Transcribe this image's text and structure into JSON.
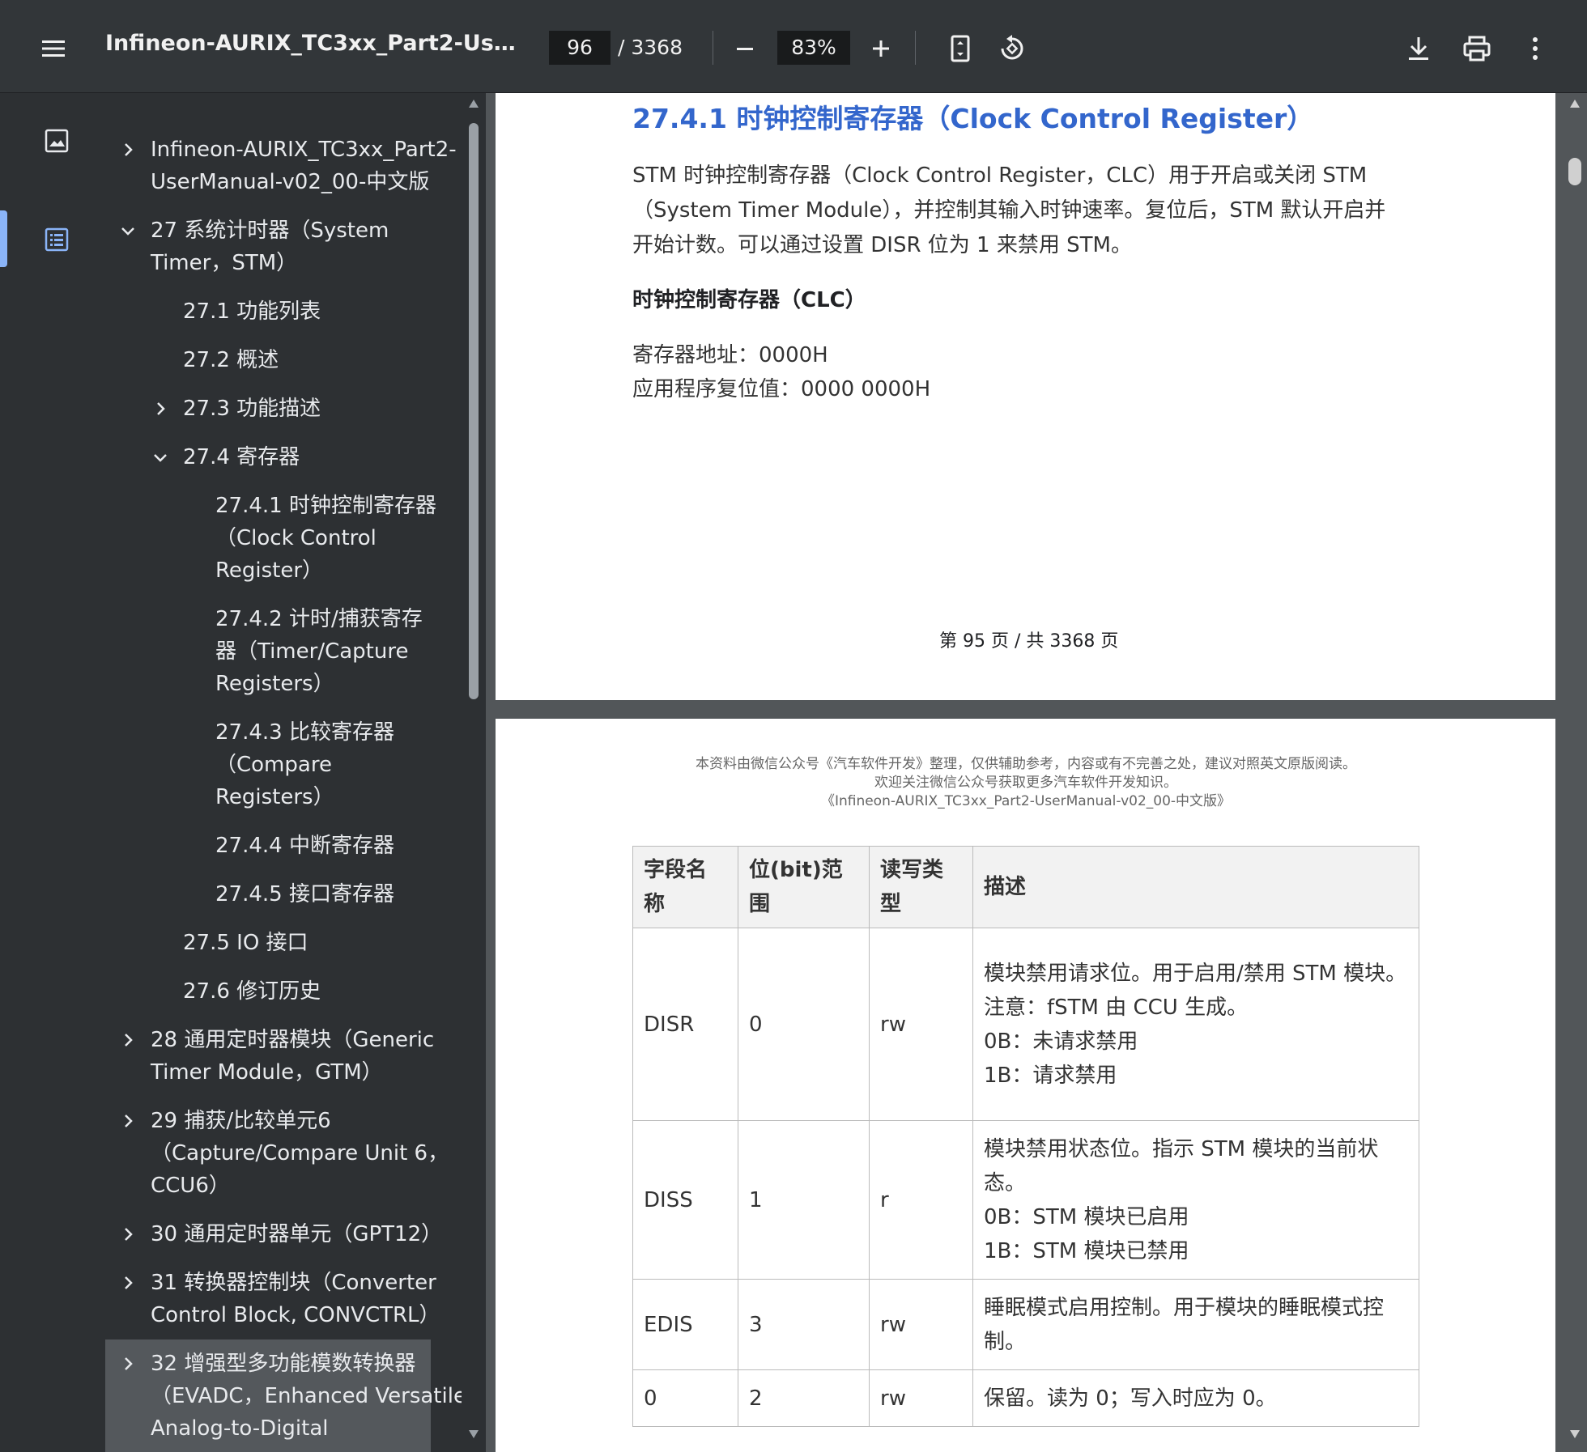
{
  "toolbar": {
    "title": "Infineon-AURIX_TC3xx_Part2-UserMan...",
    "page_current": "96",
    "page_total": "/ 3368",
    "zoom": "83%",
    "icons": [
      "menu-icon",
      "zoom-out-icon",
      "zoom-in-icon",
      "fit-page-icon",
      "rotate-icon",
      "download-icon",
      "print-icon",
      "more-vert-icon"
    ]
  },
  "outline": {
    "items": [
      {
        "label1": "Infineon-AURIX_TC3xx_Part2-",
        "label2": "UserManual-v02_00-中文版",
        "chevron": "right"
      },
      {
        "label1": "27 系统计时器（System",
        "label2": "Timer，STM）",
        "chevron": "down"
      },
      {
        "label1": "27.1 功能列表"
      },
      {
        "label1": "27.2 概述"
      },
      {
        "label1": "27.3 功能描述",
        "chevron": "right"
      },
      {
        "label1": "27.4 寄存器",
        "chevron": "down"
      },
      {
        "label1": "27.4.1 时钟控制寄存器",
        "label2": "（Clock Control",
        "label3": "Register）"
      },
      {
        "label1": "27.4.2 计时/捕获寄存",
        "label2": "器（Timer/Capture",
        "label3": "Registers）"
      },
      {
        "label1": "27.4.3 比较寄存器",
        "label2": "（Compare",
        "label3": "Registers）"
      },
      {
        "label1": "27.4.4 中断寄存器"
      },
      {
        "label1": "27.4.5 接口寄存器"
      },
      {
        "label1": "27.5 IO 接口"
      },
      {
        "label1": "27.6 修订历史"
      },
      {
        "label1": "28 通用定时器模块（Generic",
        "label2": "Timer Module，GTM）",
        "chevron": "right"
      },
      {
        "label1": "29 捕获/比较单元6",
        "label2": "（Capture/Compare Unit 6，",
        "label3": "CCU6）",
        "chevron": "right"
      },
      {
        "label1": "30 通用定时器单元（GPT12）",
        "chevron": "right"
      },
      {
        "label1": "31 转换器控制块（Converter",
        "label2": "Control Block, CONVCTRL）",
        "chevron": "right"
      },
      {
        "label1": "32 增强型多功能模数转换器",
        "label2": "（EVADC，Enhanced Versatile",
        "label3": "Analog-to-Digital",
        "chevron": "right"
      }
    ]
  },
  "page95": {
    "heading": "27.4.1 时钟控制寄存器（Clock Control Register）",
    "para_line1": "STM 时钟控制寄存器（Clock Control Register，CLC）用于开启或关闭 STM",
    "para_line2": "（System Timer Module），并控制其输入时钟速率。复位后，STM 默认开启并",
    "para_line3": "开始计数。可以通过设置 DISR 位为 1 来禁用 STM。",
    "subheading": "时钟控制寄存器（CLC）",
    "addr": "寄存器地址：0000H",
    "reset": "应用程序复位值：0000 0000H",
    "footer": "第 95 页 / 共 3368 页"
  },
  "page96": {
    "note1": "本资料由微信公众号《汽车软件开发》整理，仅供辅助参考，内容或有不完善之处，建议对照英文原版阅读。",
    "note2": "欢迎关注微信公众号获取更多汽车软件开发知识。",
    "note3": "《Infineon-AURIX_TC3xx_Part2-UserManual-v02_00-中文版》",
    "table": {
      "headers": [
        "字段名称",
        "位(bit)范围",
        "读写类型",
        "描述"
      ],
      "rows": [
        {
          "field": "DISR",
          "bits": "0",
          "type": "rw",
          "desc": [
            "模块禁用请求位。用于启用/禁用 STM 模块。",
            "注意：fSTM 由 CCU 生成。",
            "0B：未请求禁用",
            "1B：请求禁用"
          ]
        },
        {
          "field": "DISS",
          "bits": "1",
          "type": "r",
          "desc": [
            "模块禁用状态位。指示 STM 模块的当前状态。",
            "0B：STM 模块已启用",
            "1B：STM 模块已禁用"
          ]
        },
        {
          "field": "EDIS",
          "bits": "3",
          "type": "rw",
          "desc": [
            "睡眠模式启用控制。用于模块的睡眠模式控制。"
          ]
        },
        {
          "field": "0",
          "bits": "2",
          "type": "rw",
          "desc": [
            "保留。读为 0；写入时应为 0。"
          ]
        }
      ]
    }
  }
}
